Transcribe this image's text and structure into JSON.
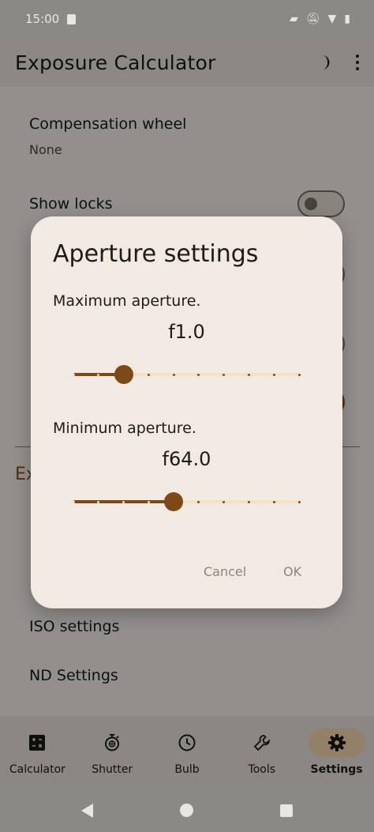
{
  "status_bar": {
    "time": "15:00"
  },
  "app_bar": {
    "title": "Exposure Calculator"
  },
  "settings": {
    "compensation_wheel": {
      "title": "Compensation wheel",
      "value": "None"
    },
    "show_locks": {
      "title": "Show locks",
      "on": false
    },
    "section_title_fragment": "Ex",
    "iso_settings": {
      "title": "ISO settings"
    },
    "nd_settings": {
      "title": "ND Settings"
    }
  },
  "dialog": {
    "title": "Aperture settings",
    "max_label": "Maximum aperture.",
    "max_value": "f1.0",
    "max_slider": {
      "steps": 10,
      "position": 2
    },
    "min_label": "Minimum aperture.",
    "min_value": "f64.0",
    "min_slider": {
      "steps": 10,
      "position": 4
    },
    "cancel": "Cancel",
    "ok": "OK"
  },
  "bottom_nav": {
    "items": [
      {
        "label": "Calculator",
        "icon": "calculator-icon",
        "active": false
      },
      {
        "label": "Shutter",
        "icon": "stopwatch-icon",
        "active": false
      },
      {
        "label": "Bulb",
        "icon": "clock-icon",
        "active": false
      },
      {
        "label": "Tools",
        "icon": "wrench-icon",
        "active": false
      },
      {
        "label": "Settings",
        "icon": "gear-icon",
        "active": true
      }
    ]
  },
  "colors": {
    "accent": "#8a5219",
    "active_nav_bg": "#fcdcb6",
    "slider_active": "#7d4a17",
    "slider_inactive": "#f6dfc2"
  }
}
